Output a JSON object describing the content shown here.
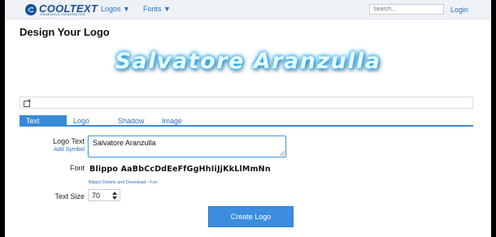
{
  "nav": {
    "logo_text": "COOLTEXT",
    "logo_subtitle": "GRAPHICS GENERATOR",
    "logos_menu": "Logos ▼",
    "fonts_menu": "Fonts ▼",
    "search_placeholder": "Search...",
    "login": "Login"
  },
  "page": {
    "title": "Design Your Logo",
    "preview_text": "Salvatore Aranzulla",
    "preview_colors": {
      "fill": "#eaffff",
      "glow": "#18a8f0"
    }
  },
  "tabs": [
    {
      "label": "Text",
      "active": true
    },
    {
      "label": "Logo",
      "active": false
    },
    {
      "label": "Shadow",
      "active": false
    },
    {
      "label": "Image",
      "active": false
    }
  ],
  "form": {
    "logo_text_label": "Logo Text",
    "add_symbol": "Add Symbol",
    "logo_text_value": "Salvatore Aranzulla",
    "font_label": "Font",
    "font_sample": "Blippo AaBbCcDdEeFfGgHhIiJjKkLlMmNn",
    "font_details": "Blippo Details and Download - Fun",
    "text_size_label": "Text Size",
    "text_size_value": "70",
    "create_button": "Create Logo"
  },
  "colors": {
    "accent": "#3a8ad6",
    "link": "#2a6fc1",
    "button": "#3c8de0"
  }
}
